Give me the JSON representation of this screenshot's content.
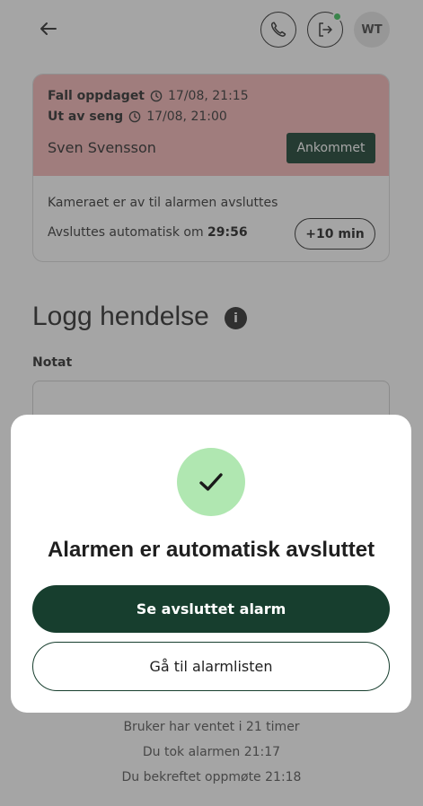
{
  "header": {
    "back_icon": "arrow-left-icon",
    "phone_icon": "phone-icon",
    "exit_icon": "exit-icon",
    "status_dot_color": "#3cc45c",
    "avatar_initials": "WT"
  },
  "alarm_card": {
    "fall_label": "Fall oppdaget",
    "fall_time": "17/08, 21:15",
    "bed_label": "Ut av seng",
    "bed_time": "17/08, 21:00",
    "resident_name": "Sven Svensson",
    "arrived_button": "Ankommet",
    "camera_info": "Kameraet er av til alarmen avsluttes",
    "auto_close_text": "Avsluttes automatisk om",
    "countdown": "29:56",
    "extend_button": "+10 min",
    "highlight_color": "#f6b7b7"
  },
  "log": {
    "title": "Logg hendelse",
    "info_icon": "info-icon",
    "note_label": "Notat"
  },
  "status_lines": [
    "Bruker har ventet i 21 timer",
    "Du tok alarmen 21:17",
    "Du bekreftet oppmøte 21:18"
  ],
  "modal": {
    "icon": "checkmark-icon",
    "title": "Alarmen er automatisk avsluttet",
    "primary_button": "Se avsluttet alarm",
    "secondary_button": "Gå til alarmlisten",
    "accent_color": "#173e2e",
    "check_bg_color": "#b0e7b1"
  }
}
